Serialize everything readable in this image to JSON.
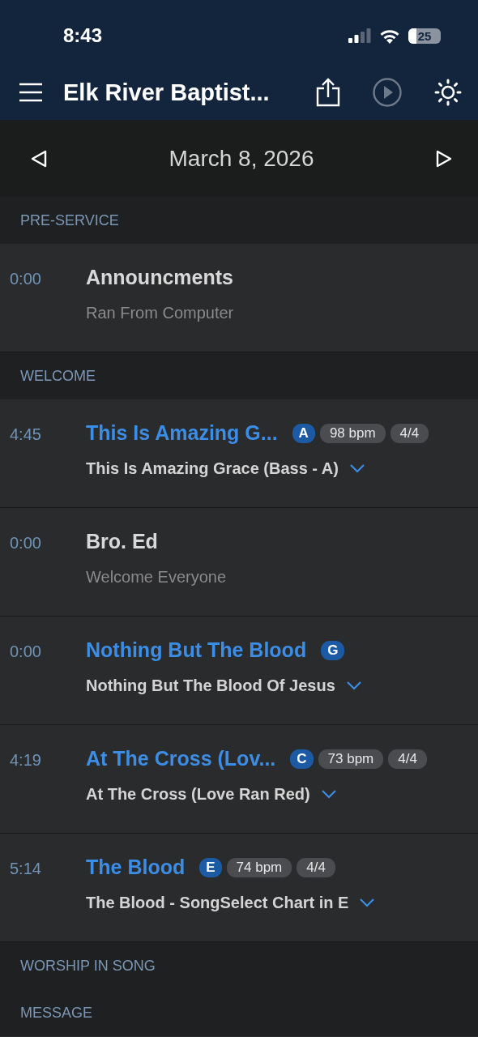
{
  "status_bar": {
    "time": "8:43",
    "battery": "25"
  },
  "header": {
    "title": "Elk River Baptist..."
  },
  "date_bar": {
    "date": "March 8, 2026"
  },
  "sections": [
    {
      "title": "PRE-SERVICE",
      "items": [
        {
          "kind": "item",
          "time": "0:00",
          "title": "Announcments",
          "subtitle": "Ran From Computer"
        }
      ]
    },
    {
      "title": "WELCOME",
      "items": [
        {
          "kind": "song",
          "time": "4:45",
          "title": "This Is Amazing G...",
          "key": "A",
          "bpm": "98 bpm",
          "meter": "4/4",
          "subtitle": "This Is Amazing Grace (Bass - A)"
        },
        {
          "kind": "item",
          "time": "0:00",
          "title": "Bro. Ed",
          "subtitle": "Welcome Everyone"
        },
        {
          "kind": "song",
          "time": "0:00",
          "title": "Nothing But The Blood",
          "key": "G",
          "subtitle": "Nothing But The Blood Of Jesus"
        },
        {
          "kind": "song",
          "time": "4:19",
          "title": "At The Cross (Lov...",
          "key": "C",
          "bpm": "73 bpm",
          "meter": "4/4",
          "subtitle": "At The Cross (Love Ran Red)"
        },
        {
          "kind": "song",
          "time": "5:14",
          "title": "The Blood",
          "key": "E",
          "bpm": "74 bpm",
          "meter": "4/4",
          "subtitle": "The Blood - SongSelect Chart in E"
        }
      ]
    },
    {
      "title": "WORSHIP IN SONG"
    },
    {
      "title": "MESSAGE"
    }
  ]
}
